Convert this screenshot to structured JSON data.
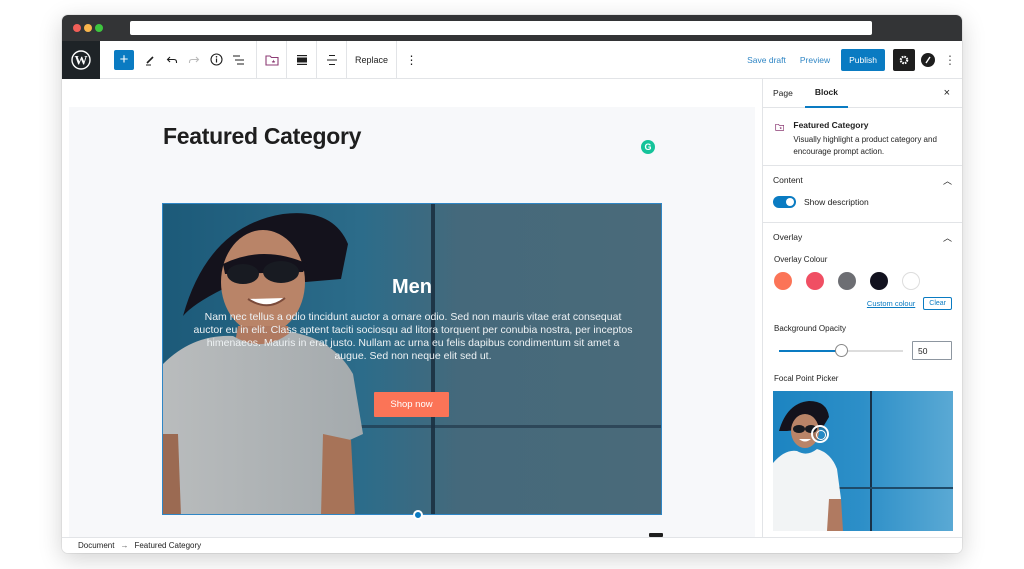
{
  "toolbar": {
    "add_block": "+",
    "tools": [
      "add-block",
      "edit",
      "undo",
      "redo",
      "info",
      "list-view"
    ],
    "block_tools": [
      "featured-category",
      "align",
      "content-position"
    ],
    "replace_label": "Replace",
    "more_label": "⋮",
    "save_draft": "Save draft",
    "preview": "Preview",
    "publish": "Publish",
    "settings_icon": "gear-icon",
    "jetpack_icon": "jetpack-icon",
    "options_label": "⋮"
  },
  "editor": {
    "page_title": "Featured Category",
    "grammarly_icon": "G",
    "block": {
      "category_title": "Men",
      "description": "Nam nec tellus a odio tincidunt auctor a ornare odio. Sed non mauris vitae erat consequat auctor eu in elit. Class aptent taciti sociosqu ad litora torquent per conubia nostra, per inceptos himenaeos. Mauris in erat justo. Nullam ac urna eu felis dapibus condimentum sit amet a augue. Sed non neque elit sed ut.",
      "button_label": "Shop now",
      "button_color": "#fb7457"
    }
  },
  "footer": {
    "breadcrumb": [
      "Document",
      "Featured Category"
    ],
    "arrow": "→"
  },
  "sidebar": {
    "tabs": [
      {
        "label": "Page",
        "active": false
      },
      {
        "label": "Block",
        "active": true
      }
    ],
    "close_label": "×",
    "block_card": {
      "title": "Featured Category",
      "description": "Visually highlight a product category and encourage prompt action."
    },
    "content_panel": {
      "title": "Content",
      "toggle_label": "Show description",
      "toggle_on": true
    },
    "overlay_panel": {
      "title": "Overlay",
      "colour_label": "Overlay Colour",
      "swatches": [
        "#fb7457",
        "#f04f63",
        "#6d6e73",
        "#12121f",
        "#ffffff"
      ],
      "custom_colour": "Custom colour",
      "clear": "Clear",
      "opacity_label": "Background Opacity",
      "opacity_value": "50",
      "opacity_percent": 50,
      "focal_label": "Focal Point Picker"
    }
  },
  "colors": {
    "accent": "#0a7bc2",
    "toolbar_dark": "#1e2327",
    "chrome": "#333436"
  }
}
